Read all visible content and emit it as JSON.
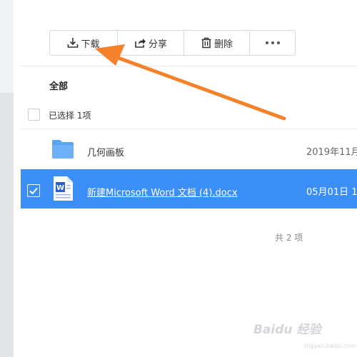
{
  "toolbar": {
    "download_label": "下载",
    "share_label": "分享",
    "delete_label": "删除"
  },
  "list": {
    "all_label": "全部",
    "selected_count": "已选择 1项",
    "rows": [
      {
        "name": "几何画板",
        "date": "2019年11月",
        "type": "folder",
        "selected": false
      },
      {
        "name": "新建Microsoft Word 文档 (4).docx",
        "date": "05月01日 1",
        "type": "word",
        "selected": true
      }
    ],
    "total": "共 2 项"
  },
  "icons": {
    "download": "download-icon",
    "share": "share-icon",
    "delete": "trash-icon",
    "more": "more-dots-icon",
    "folder": "folder-icon",
    "word": "word-file-icon",
    "check": "check-icon"
  },
  "colors": {
    "selected_row": "#3a8ef6",
    "annotation_arrow": "#f5812a",
    "folder": "#5aa2f2",
    "word": "#2b5fc7"
  },
  "watermark": {
    "text": "Baidu 经验",
    "sub": "jingyan.baidu.com"
  }
}
